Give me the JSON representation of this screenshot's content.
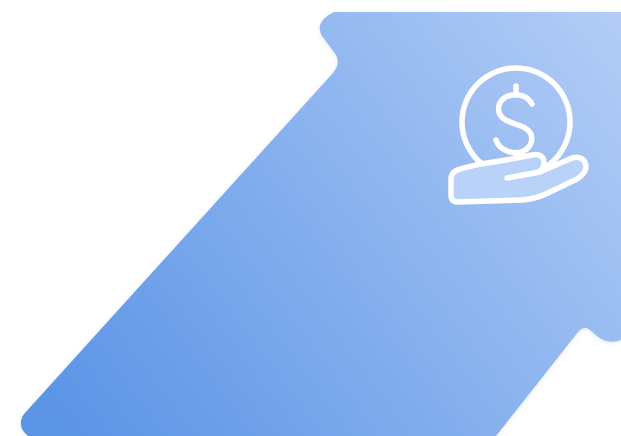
{
  "illustration": {
    "shape": "diagonal-up-arrow",
    "icon": "hand-holding-dollar-icon",
    "colors": {
      "background": "#ffffff",
      "arrow_start": "#5b94e6",
      "arrow_end": "#b3cdf6",
      "icon_stroke": "#ffffff"
    }
  }
}
